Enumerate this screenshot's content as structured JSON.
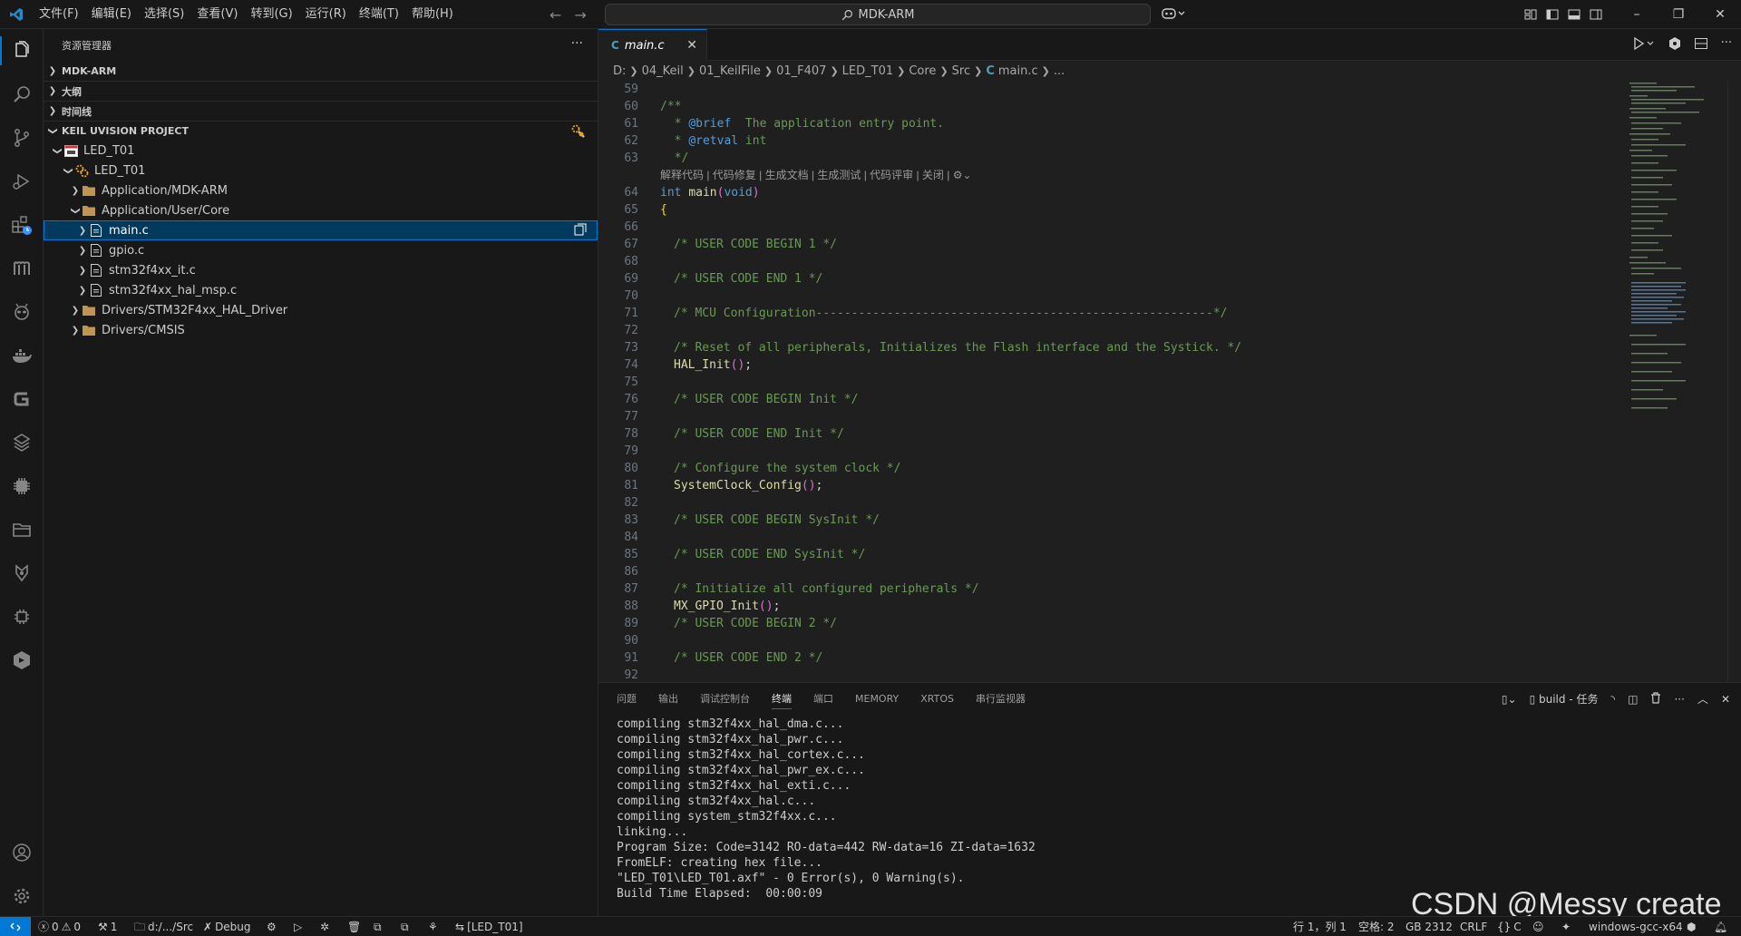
{
  "titlebar": {
    "menu": [
      "文件(F)",
      "编辑(E)",
      "选择(S)",
      "查看(V)",
      "转到(G)",
      "运行(R)",
      "终端(T)",
      "帮助(H)"
    ],
    "search_text": "MDK-ARM",
    "win_min": "–",
    "win_max": "❐",
    "win_close": "✕"
  },
  "sidebar": {
    "title": "资源管理器",
    "sections": {
      "mdk": "MDK-ARM",
      "outline": "大纲",
      "timeline": "时间线",
      "keil": "KEIL UVISION PROJECT"
    },
    "tree": {
      "project": "LED_T01",
      "target": "LED_T01",
      "group_mdk": "Application/MDK-ARM",
      "group_core": "Application/User/Core",
      "files": [
        "main.c",
        "gpio.c",
        "stm32f4xx_it.c",
        "stm32f4xx_hal_msp.c"
      ],
      "group_hal": "Drivers/STM32F4xx_HAL_Driver",
      "group_cmsis": "Drivers/CMSIS"
    }
  },
  "editor": {
    "tab_name": "main.c",
    "breadcrumb": [
      "D:",
      "04_Keil",
      "01_KeilFile",
      "01_F407",
      "LED_T01",
      "Core",
      "Src",
      "main.c",
      "..."
    ],
    "codelens": "解释代码 | 代码修复 | 生成文档 | 生成测试 | 代码评审 | 关闭 | ",
    "line_numbers": [
      "59",
      "60",
      "61",
      "62",
      "63",
      "64",
      "65",
      "66",
      "67",
      "68",
      "69",
      "70",
      "71",
      "72",
      "73",
      "74",
      "75",
      "76",
      "77",
      "78",
      "79",
      "80",
      "81",
      "82",
      "83",
      "84",
      "85",
      "86",
      "87",
      "88",
      "89",
      "90",
      "91",
      "92"
    ],
    "code": {
      "l60": "/**",
      "l61_prefix": "  * ",
      "l61_tag": "@brief",
      "l61_text": "  The application entry point.",
      "l62_prefix": "  * ",
      "l62_tag": "@retval",
      "l62_text": " int",
      "l63": "  */",
      "l64_kw": "int",
      "l64_fn": "main",
      "l64_p1": "(",
      "l64_void": "void",
      "l64_p2": ")",
      "l65": "{",
      "l67": "/* USER CODE BEGIN 1 */",
      "l69": "/* USER CODE END 1 */",
      "l71": "/* MCU Configuration--------------------------------------------------------*/",
      "l73": "/* Reset of all peripherals, Initializes the Flash interface and the Systick. */",
      "l74_fn": "HAL_Init",
      "l74_p": "()",
      "l74_semi": ";",
      "l76": "/* USER CODE BEGIN Init */",
      "l78": "/* USER CODE END Init */",
      "l80": "/* Configure the system clock */",
      "l81_fn": "SystemClock_Config",
      "l81_p": "()",
      "l81_semi": ";",
      "l83": "/* USER CODE BEGIN SysInit */",
      "l85": "/* USER CODE END SysInit */",
      "l87": "/* Initialize all configured peripherals */",
      "l88_fn": "MX_GPIO_Init",
      "l88_p": "()",
      "l88_semi": ";",
      "l89": "/* USER CODE BEGIN 2 */",
      "l91": "/* USER CODE END 2 */"
    }
  },
  "panel": {
    "tabs": [
      "问题",
      "输出",
      "调试控制台",
      "终端",
      "端口",
      "MEMORY",
      "XRTOS",
      "串行监视器"
    ],
    "active_tab": "终端",
    "task_label": "build - 任务",
    "terminal_lines": [
      "compiling stm32f4xx_hal_dma.c...",
      "compiling stm32f4xx_hal_pwr.c...",
      "compiling stm32f4xx_hal_cortex.c...",
      "compiling stm32f4xx_hal_pwr_ex.c...",
      "compiling stm32f4xx_hal_exti.c...",
      "compiling stm32f4xx_hal.c...",
      "compiling system_stm32f4xx.c...",
      "linking...",
      "Program Size: Code=3142 RO-data=442 RW-data=16 ZI-data=1632",
      "FromELF: creating hex file...",
      "\"LED_T01\\LED_T01.axf\" - 0 Error(s), 0 Warning(s).",
      "Build Time Elapsed:  00:00:09"
    ]
  },
  "watermark": "CSDN @Messy create",
  "statusbar": {
    "errors": "0",
    "warnings": "0",
    "ports": "1",
    "folder": "d:/.../Src",
    "debug": "Debug",
    "target": "[LED_T01]",
    "position": "行 1，列 1",
    "spaces": "空格: 2",
    "encoding": "GB 2312",
    "eol": "CRLF",
    "language": "C",
    "toolchain": "windows-gcc-x64"
  },
  "colors": {
    "accent": "#0078d4",
    "comment": "#6a9955",
    "keyword": "#569cd6",
    "function": "#dcdcaa"
  }
}
